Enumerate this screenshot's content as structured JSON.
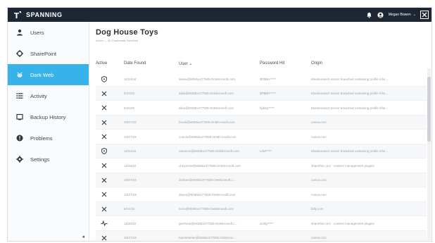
{
  "app": {
    "brand": "SPANNING"
  },
  "topbar": {
    "user_name": "Megan Bowen",
    "user_caret": "⌄"
  },
  "sidebar": {
    "items": [
      {
        "label": "Users",
        "icon": "user-icon",
        "active": false
      },
      {
        "label": "SharePoint",
        "icon": "sharepoint-icon",
        "active": false
      },
      {
        "label": "Dark Web",
        "icon": "dark-web-icon",
        "active": true
      },
      {
        "label": "Activity",
        "icon": "activity-list-icon",
        "active": false
      },
      {
        "label": "Backup History",
        "icon": "backup-history-icon",
        "active": false
      },
      {
        "label": "Problems",
        "icon": "problems-icon",
        "active": false
      },
      {
        "label": "Settings",
        "icon": "settings-gear-icon",
        "active": false
      }
    ],
    "collapse_glyph": "◂"
  },
  "page": {
    "title": "Dog House Toys",
    "subtitle": "Active — 30 Credentials Detected"
  },
  "table": {
    "headers": {
      "active": "Active",
      "date": "Date Found",
      "user": "User ⌄",
      "password": "Password Hit",
      "origin": "Origin"
    },
    "rows": [
      {
        "status": "shield",
        "date": "11/24/18",
        "user": "alexw@M365x477509.OnMicrosoft.com",
        "password": "$P$BH*****",
        "origin": "Elasticsearch server breached containing profile infor..."
      },
      {
        "status": "x",
        "date": "5/24/20",
        "user": "adiia@M365x477509.OnMicrosoft.com",
        "password": "$P$BH*****",
        "origin": "Elasticsearch server breached containing profile infor..."
      },
      {
        "status": "x",
        "date": "5/24/20",
        "user": "alina@M365x477509.OnMicrosoft.com",
        "password": "hjdsfg*****",
        "origin": "Elasticsearch server breached containing profile infor..."
      },
      {
        "status": "x",
        "date": "10/27/19",
        "user": "brook@M365x477509.OnMicrosoft.com",
        "password": "",
        "origin": "canva.com"
      },
      {
        "status": "x",
        "date": "10/27/19",
        "user": "connie@M365x477509.OnMicrosoft.com",
        "password": "",
        "origin": "canva.com"
      },
      {
        "status": "shield",
        "date": "11/24/18",
        "user": "cameron@M365x477509.OnMicrosoft.com",
        "password": "c4M*****",
        "origin": "Elasticsearch server breached containing profile infor..."
      },
      {
        "status": "x",
        "date": "11/28/19",
        "user": "cheyenne@M365x477509.OnMicrosoft.com",
        "password": "",
        "origin": "sharethis.com - content management plugins"
      },
      {
        "status": "x",
        "date": "10/27/19",
        "user": "dosbee@M365x477509.OnMicrosoft.c...",
        "password": "",
        "origin": "canva.com"
      },
      {
        "status": "x",
        "date": "10/27/19",
        "user": "davex@M365x477509.OnMicrosoft.com",
        "password": "",
        "origin": "canva.com"
      },
      {
        "status": "x",
        "date": "6/14/19",
        "user": "enzo@M365x477509.OnMicrosoft.com",
        "password": "",
        "origin": "bitly.com"
      },
      {
        "status": "pulse",
        "date": "11/28/19",
        "user": "genhurst@M365x477509.OnMicrosoft.c...",
        "password": "azsfg*****",
        "origin": "sharethis.com - content management plugins"
      },
      {
        "status": "x",
        "date": "10/27/19",
        "user": "harrwheeler@M365x477509.OnMicros...",
        "password": "",
        "origin": "canva.com"
      }
    ]
  },
  "colors": {
    "topbar": "#1d2633",
    "active_nav": "#38b3ea",
    "sidebar_bg": "#fafbfc",
    "icon_dark": "#2f3640"
  }
}
